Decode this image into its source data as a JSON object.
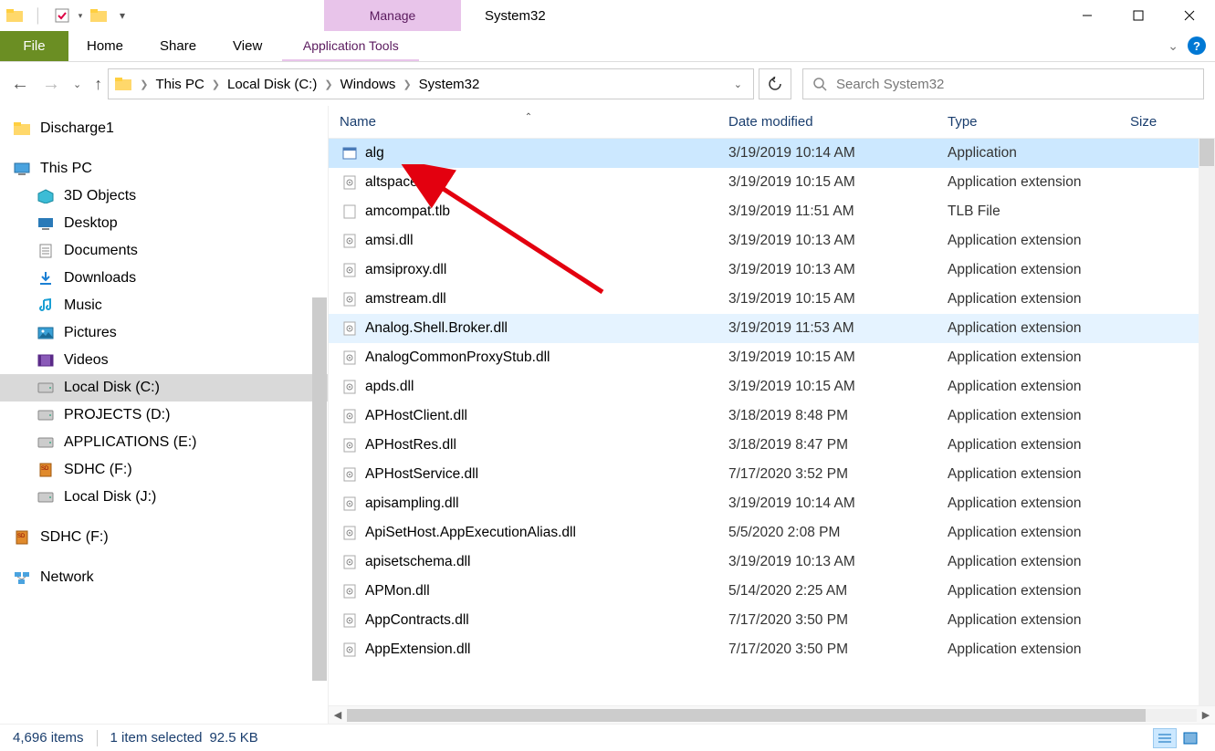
{
  "window": {
    "title": "System32",
    "manage_tab": "Manage",
    "app_tools": "Application Tools"
  },
  "ribbon": {
    "file": "File",
    "tabs": [
      "Home",
      "Share",
      "View"
    ]
  },
  "breadcrumb": {
    "parts": [
      "This PC",
      "Local Disk (C:)",
      "Windows",
      "System32"
    ]
  },
  "search": {
    "placeholder": "Search System32"
  },
  "sidebar": {
    "quick": "Discharge1",
    "thispc": "This PC",
    "items": [
      "3D Objects",
      "Desktop",
      "Documents",
      "Downloads",
      "Music",
      "Pictures",
      "Videos",
      "Local Disk (C:)",
      "PROJECTS (D:)",
      "APPLICATIONS (E:)",
      "SDHC (F:)",
      "Local Disk (J:)"
    ],
    "extra_drive": "SDHC (F:)",
    "network": "Network"
  },
  "columns": {
    "name": "Name",
    "date": "Date modified",
    "type": "Type",
    "size": "Size"
  },
  "files": [
    {
      "name": "alg",
      "date": "3/19/2019 10:14 AM",
      "type": "Application",
      "icon": "app"
    },
    {
      "name": "altspace.dll",
      "date": "3/19/2019 10:15 AM",
      "type": "Application extension",
      "icon": "dll"
    },
    {
      "name": "amcompat.tlb",
      "date": "3/19/2019 11:51 AM",
      "type": "TLB File",
      "icon": "file"
    },
    {
      "name": "amsi.dll",
      "date": "3/19/2019 10:13 AM",
      "type": "Application extension",
      "icon": "dll"
    },
    {
      "name": "amsiproxy.dll",
      "date": "3/19/2019 10:13 AM",
      "type": "Application extension",
      "icon": "dll"
    },
    {
      "name": "amstream.dll",
      "date": "3/19/2019 10:15 AM",
      "type": "Application extension",
      "icon": "dll"
    },
    {
      "name": "Analog.Shell.Broker.dll",
      "date": "3/19/2019 11:53 AM",
      "type": "Application extension",
      "icon": "dll"
    },
    {
      "name": "AnalogCommonProxyStub.dll",
      "date": "3/19/2019 10:15 AM",
      "type": "Application extension",
      "icon": "dll"
    },
    {
      "name": "apds.dll",
      "date": "3/19/2019 10:15 AM",
      "type": "Application extension",
      "icon": "dll"
    },
    {
      "name": "APHostClient.dll",
      "date": "3/18/2019 8:48 PM",
      "type": "Application extension",
      "icon": "dll"
    },
    {
      "name": "APHostRes.dll",
      "date": "3/18/2019 8:47 PM",
      "type": "Application extension",
      "icon": "dll"
    },
    {
      "name": "APHostService.dll",
      "date": "7/17/2020 3:52 PM",
      "type": "Application extension",
      "icon": "dll"
    },
    {
      "name": "apisampling.dll",
      "date": "3/19/2019 10:14 AM",
      "type": "Application extension",
      "icon": "dll"
    },
    {
      "name": "ApiSetHost.AppExecutionAlias.dll",
      "date": "5/5/2020 2:08 PM",
      "type": "Application extension",
      "icon": "dll"
    },
    {
      "name": "apisetschema.dll",
      "date": "3/19/2019 10:13 AM",
      "type": "Application extension",
      "icon": "dll"
    },
    {
      "name": "APMon.dll",
      "date": "5/14/2020 2:25 AM",
      "type": "Application extension",
      "icon": "dll"
    },
    {
      "name": "AppContracts.dll",
      "date": "7/17/2020 3:50 PM",
      "type": "Application extension",
      "icon": "dll"
    },
    {
      "name": "AppExtension.dll",
      "date": "7/17/2020 3:50 PM",
      "type": "Application extension",
      "icon": "dll"
    }
  ],
  "selected_index": 0,
  "hover_index": 6,
  "status": {
    "count": "4,696 items",
    "selection": "1 item selected",
    "size": "92.5 KB"
  }
}
